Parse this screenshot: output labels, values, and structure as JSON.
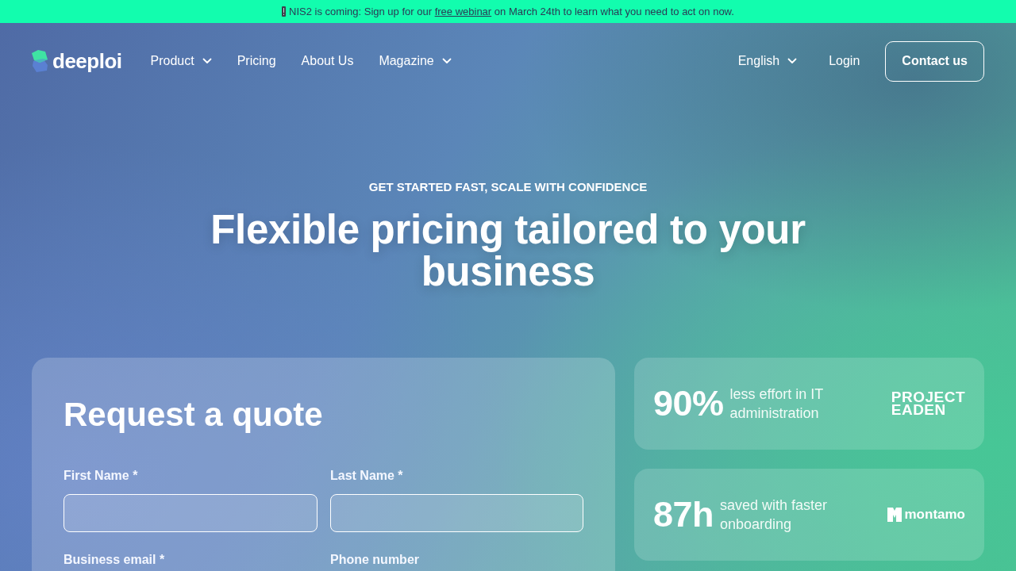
{
  "banner": {
    "text_before": "NIS2 is coming: Sign up for our",
    "link": "free webinar",
    "text_after": "on March 24th to learn what you need to act on now."
  },
  "nav": {
    "logo": "deeploi",
    "items": [
      {
        "label": "Product",
        "dropdown": true
      },
      {
        "label": "Pricing",
        "dropdown": false
      },
      {
        "label": "About Us",
        "dropdown": false
      },
      {
        "label": "Magazine",
        "dropdown": true
      }
    ],
    "language": {
      "label": "English",
      "dropdown": true
    },
    "login": "Login",
    "cta": "Contact us"
  },
  "hero": {
    "eyebrow": "GET STARTED FAST, SCALE WITH CONFIDENCE",
    "title": "Flexible pricing tailored to your business"
  },
  "form": {
    "title": "Request a quote",
    "fields": [
      {
        "label": "First Name *",
        "kind": "input"
      },
      {
        "label": "Last Name *",
        "kind": "input"
      },
      {
        "label": "Business email *",
        "kind": "label"
      },
      {
        "label": "Phone number",
        "kind": "label"
      }
    ]
  },
  "stats": [
    {
      "value": "90%",
      "text": "less effort in IT administration",
      "logo": {
        "kind": "wordmark",
        "text": "PROJECT EADEN"
      }
    },
    {
      "value": "87h",
      "text": "saved with faster onboarding",
      "logo": {
        "kind": "icon-wordmark",
        "text": "montamo"
      }
    }
  ]
}
